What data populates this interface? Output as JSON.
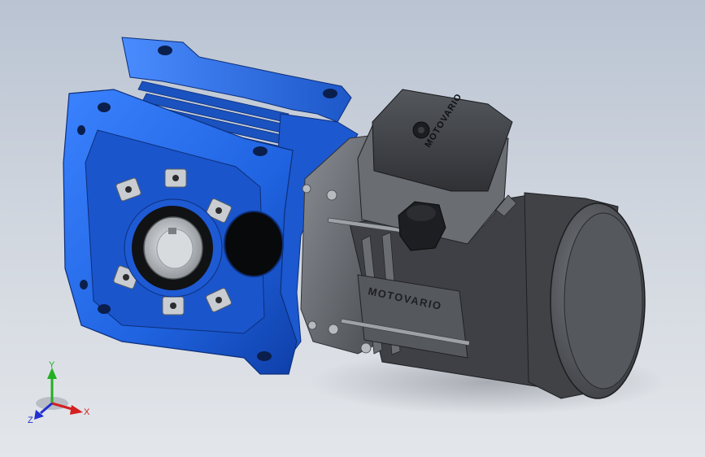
{
  "viewport": {
    "background_top": "#b9c3d2",
    "background_bottom": "#e3e6ea"
  },
  "model": {
    "gearbox_color": "#1f63e0",
    "motor_color": "#5a5d62",
    "terminal_box_label": "MOTOVARIO",
    "motor_body_label": "MOTOVARIO"
  },
  "triad": {
    "x_label": "X",
    "y_label": "Y",
    "z_label": "Z",
    "x_color": "#d42020",
    "y_color": "#22b022",
    "z_color": "#2030d0"
  }
}
